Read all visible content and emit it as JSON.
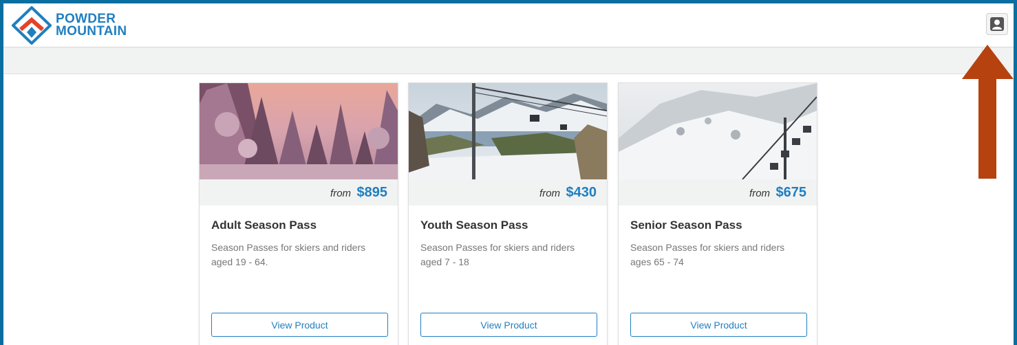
{
  "header": {
    "logo_line1": "POWDER",
    "logo_line2": "MOUNTAIN",
    "account_icon": "account-icon"
  },
  "products": [
    {
      "from_label": "from",
      "price": "$895",
      "title": "Adult Season Pass",
      "description": "Season Passes for skiers and riders aged 19 - 64.",
      "button_label": "View Product",
      "image": "snowy-forest-sunset"
    },
    {
      "from_label": "from",
      "price": "$430",
      "title": "Youth Season Pass",
      "description": "Season Passes for skiers and riders aged 7 - 18",
      "button_label": "View Product",
      "image": "mountain-valley-ski-lift"
    },
    {
      "from_label": "from",
      "price": "$675",
      "title": "Senior Season Pass",
      "description": "Season Passes for skiers and riders ages 65 - 74",
      "button_label": "View Product",
      "image": "snowy-slope-chairlift"
    }
  ],
  "colors": {
    "brand_blue": "#1f7fc0",
    "frame_blue": "#0a6ea0",
    "annotation_arrow": "#b6420f",
    "logo_red": "#e0452b"
  }
}
